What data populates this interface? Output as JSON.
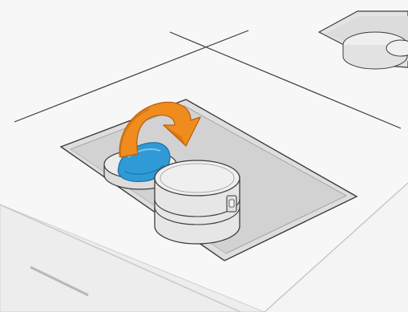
{
  "illustration": {
    "icons": [
      "orange-curved-arrow",
      "blue-material-bag",
      "container-latch"
    ],
    "colors": {
      "background": "#f2f2f2",
      "surface": "#f7f7f7",
      "line": "#3c3c3c",
      "arrow_orange": "#f08c1e",
      "arrow_orange_dark": "#c96a0e",
      "bag_blue": "#2f9ad6",
      "bag_blue_dark": "#1f7ab2",
      "container_light": "#ededed",
      "container_mid": "#d9d9d9"
    }
  }
}
